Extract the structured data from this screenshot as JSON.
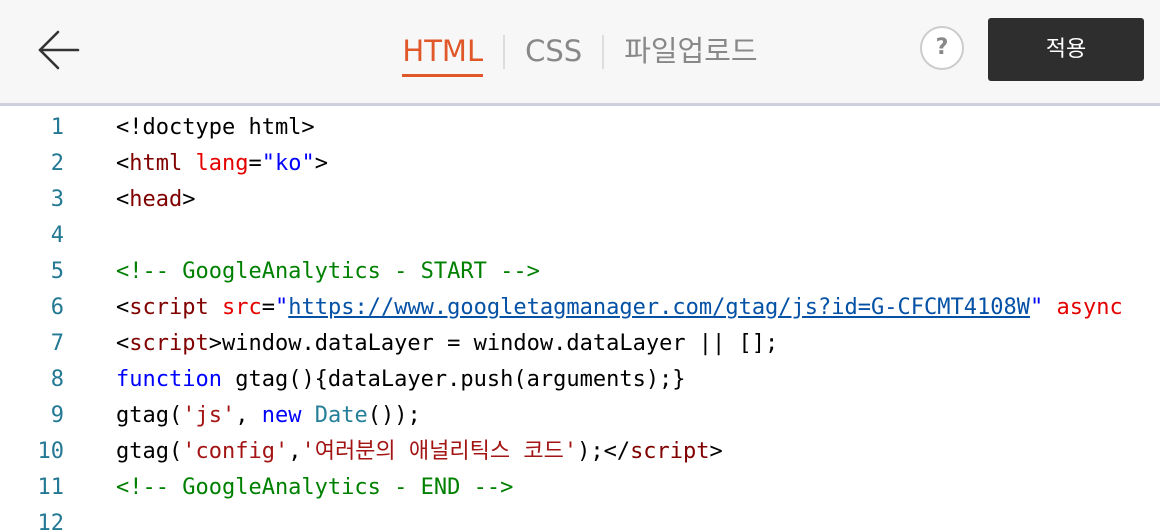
{
  "header": {
    "tabs": [
      {
        "label": "HTML",
        "active": true
      },
      {
        "label": "CSS",
        "active": false
      },
      {
        "label": "파일업로드",
        "active": false
      }
    ],
    "help_label": "?",
    "apply_label": "적용",
    "back_icon": "arrow-left-icon"
  },
  "colors": {
    "accent": "#e0572a",
    "apply_bg": "#2e2e2e",
    "line_number": "#237893"
  },
  "editor": {
    "lines": [
      {
        "num": "1",
        "segments": [
          {
            "t": "<!doctype html>",
            "c": ""
          }
        ]
      },
      {
        "num": "2",
        "segments": [
          {
            "t": "<",
            "c": ""
          },
          {
            "t": "html",
            "c": "c-tag"
          },
          {
            "t": " ",
            "c": ""
          },
          {
            "t": "lang",
            "c": "c-attr"
          },
          {
            "t": "=",
            "c": ""
          },
          {
            "t": "\"ko\"",
            "c": "c-str"
          },
          {
            "t": ">",
            "c": ""
          }
        ]
      },
      {
        "num": "3",
        "segments": [
          {
            "t": "<",
            "c": ""
          },
          {
            "t": "head",
            "c": "c-tag"
          },
          {
            "t": ">",
            "c": ""
          }
        ]
      },
      {
        "num": "4",
        "segments": []
      },
      {
        "num": "5",
        "segments": [
          {
            "t": "<!-- GoogleAnalytics - START -->",
            "c": "c-cmt"
          }
        ]
      },
      {
        "num": "6",
        "segments": [
          {
            "t": "<",
            "c": ""
          },
          {
            "t": "script",
            "c": "c-tag"
          },
          {
            "t": " ",
            "c": ""
          },
          {
            "t": "src",
            "c": "c-attr"
          },
          {
            "t": "=",
            "c": ""
          },
          {
            "t": "\"",
            "c": "c-str"
          },
          {
            "t": "https://www.googletagmanager.com/gtag/js?id=G-CFCMT4108W",
            "c": "c-url"
          },
          {
            "t": "\"",
            "c": "c-str"
          },
          {
            "t": " ",
            "c": ""
          },
          {
            "t": "async",
            "c": "c-attr"
          }
        ]
      },
      {
        "num": "7",
        "segments": [
          {
            "t": "<",
            "c": ""
          },
          {
            "t": "script",
            "c": "c-tag"
          },
          {
            "t": ">window.dataLayer = window.dataLayer || [];",
            "c": ""
          }
        ]
      },
      {
        "num": "8",
        "segments": [
          {
            "t": "function",
            "c": "c-kw"
          },
          {
            "t": " gtag(){dataLayer.push(arguments);}",
            "c": ""
          }
        ]
      },
      {
        "num": "9",
        "segments": [
          {
            "t": "gtag(",
            "c": ""
          },
          {
            "t": "'js'",
            "c": "c-js-str"
          },
          {
            "t": ", ",
            "c": ""
          },
          {
            "t": "new",
            "c": "c-kw"
          },
          {
            "t": " ",
            "c": ""
          },
          {
            "t": "Date",
            "c": "c-type"
          },
          {
            "t": "());",
            "c": ""
          }
        ]
      },
      {
        "num": "10",
        "segments": [
          {
            "t": "gtag(",
            "c": ""
          },
          {
            "t": "'config'",
            "c": "c-js-str"
          },
          {
            "t": ",",
            "c": ""
          },
          {
            "t": "'여러분의 애널리틱스 코드'",
            "c": "c-js-str"
          },
          {
            "t": ");</",
            "c": ""
          },
          {
            "t": "script",
            "c": "c-tag"
          },
          {
            "t": ">",
            "c": ""
          }
        ]
      },
      {
        "num": "11",
        "segments": [
          {
            "t": "<!-- GoogleAnalytics - END -->",
            "c": "c-cmt"
          }
        ]
      },
      {
        "num": "12",
        "segments": []
      }
    ]
  }
}
